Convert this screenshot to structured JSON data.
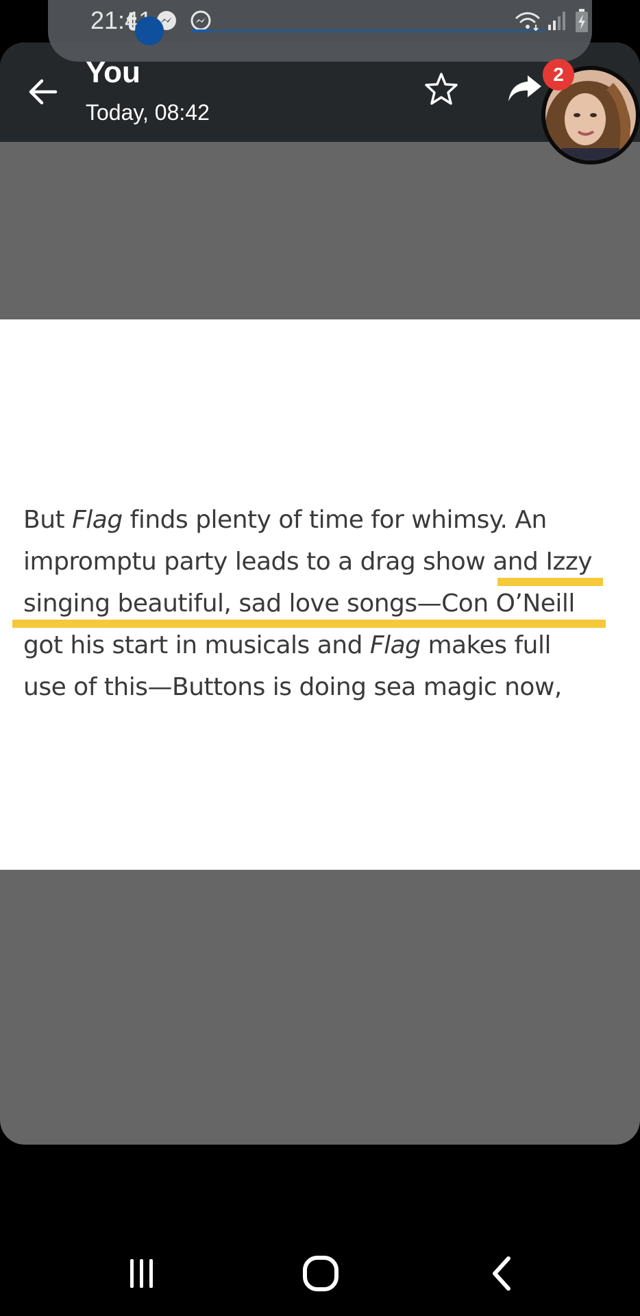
{
  "status_bar": {
    "time": "21:41",
    "notification_icons": [
      "tumblr-icon",
      "messenger-icon",
      "messenger-outline-icon"
    ],
    "system_icons": [
      "wifi-icon",
      "signal-icon",
      "battery-charging-icon"
    ],
    "media_progress": 0.05
  },
  "viewer": {
    "sender": "You",
    "timestamp": "Today, 08:42",
    "back_icon": "arrow-left-icon",
    "star_icon": "star-outline-icon",
    "share_icon": "share-arrow-icon"
  },
  "shared_image": {
    "lines": [
      {
        "before": "But ",
        "italic": "Flag",
        "after": " finds plenty of time for whimsy. An"
      },
      {
        "before": "impromptu party leads to a drag show and Izzy",
        "italic": "",
        "after": ""
      },
      {
        "before": "singing beautiful, sad love songs—Con O’Neill",
        "italic": "",
        "after": ""
      },
      {
        "before": "got his start in musicals and ",
        "italic": "Flag",
        "after": " makes full"
      },
      {
        "before": "use of this—Buttons is doing sea magic now,",
        "italic": "",
        "after": ""
      }
    ],
    "highlight_color": "#f5c93a"
  },
  "chat_head": {
    "unread_count": "2"
  },
  "nav_bar": {
    "recents_icon": "recents-icon",
    "home_icon": "home-icon",
    "back_icon": "nav-back-icon"
  }
}
